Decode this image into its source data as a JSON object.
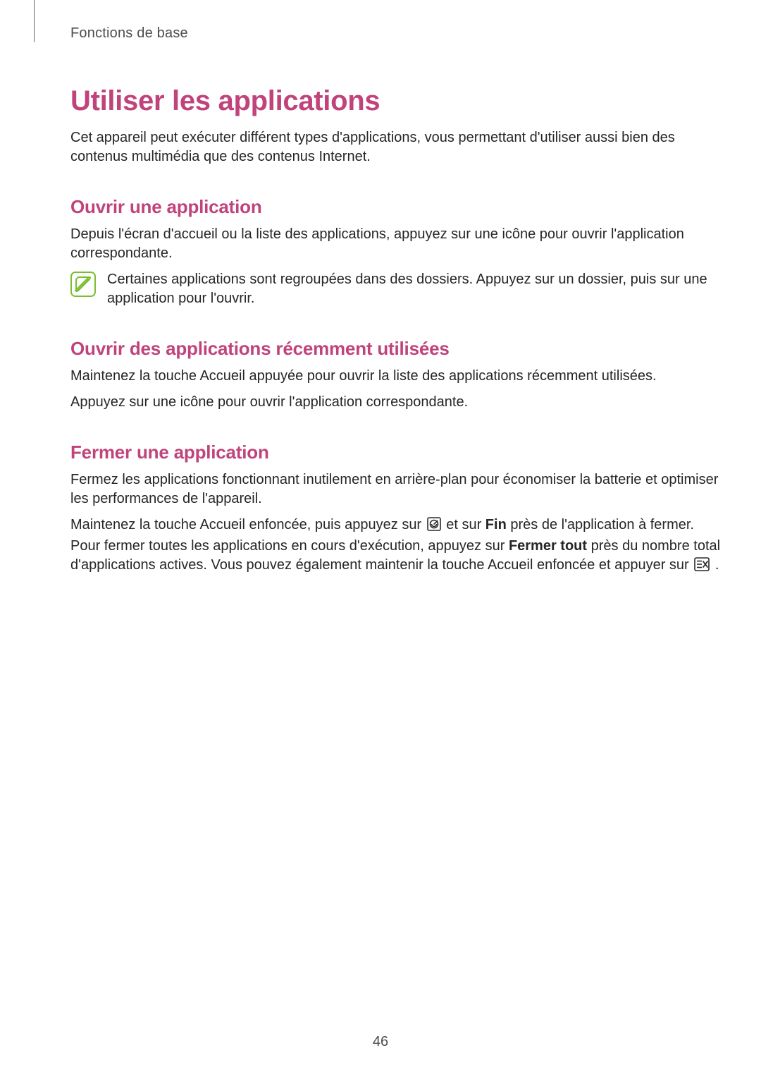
{
  "breadcrumb": "Fonctions de base",
  "title": "Utiliser les applications",
  "intro": "Cet appareil peut exécuter différent types d'applications, vous permettant d'utiliser aussi bien des contenus multimédia que des contenus Internet.",
  "section_open": {
    "heading": "Ouvrir une application",
    "body": "Depuis l'écran d'accueil ou la liste des applications, appuyez sur une icône pour ouvrir l'application correspondante.",
    "note": "Certaines applications sont regroupées dans des dossiers. Appuyez sur un dossier, puis sur une application pour l'ouvrir."
  },
  "section_recent": {
    "heading": "Ouvrir des applications récemment utilisées",
    "body1": "Maintenez la touche Accueil appuyée pour ouvrir la liste des applications récemment utilisées.",
    "body2": "Appuyez sur une icône pour ouvrir l'application correspondante."
  },
  "section_close": {
    "heading": "Fermer une application",
    "body1": "Fermez les applications fonctionnant inutilement en arrière-plan pour économiser la batterie et optimiser les performances de l'appareil.",
    "p2_a": "Maintenez la touche Accueil enfoncée, puis appuyez sur ",
    "p2_b": " et sur ",
    "p2_bold1": "Fin",
    "p2_c": " près de l'application à fermer. Pour fermer toutes les applications en cours d'exécution, appuyez sur ",
    "p2_bold2": "Fermer tout",
    "p2_d": " près du nombre total d'applications actives. Vous pouvez également maintenir la touche Accueil enfoncée et appuyer sur ",
    "p2_e": "."
  },
  "page_number": "46"
}
